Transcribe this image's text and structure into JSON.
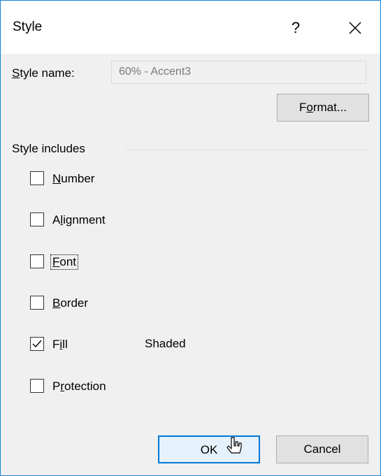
{
  "window": {
    "title": "Style",
    "help_label": "?",
    "close_icon": "close-icon"
  },
  "style_name": {
    "label": "Style name:",
    "value": "60% - Accent3"
  },
  "buttons": {
    "format": "Format...",
    "ok": "OK",
    "cancel": "Cancel"
  },
  "style_includes": {
    "group_label": "Style includes",
    "items": [
      {
        "label": "Number",
        "checked": false
      },
      {
        "label": "Alignment",
        "checked": false
      },
      {
        "label": "Font",
        "checked": false
      },
      {
        "label": "Border",
        "checked": false
      },
      {
        "label": "Fill",
        "checked": true,
        "detail": "Shaded"
      },
      {
        "label": "Protection",
        "checked": false
      }
    ]
  },
  "colors": {
    "accent": "#0078d7",
    "window_border": "#1883d7",
    "dialog_bg": "#f0f0f0"
  }
}
